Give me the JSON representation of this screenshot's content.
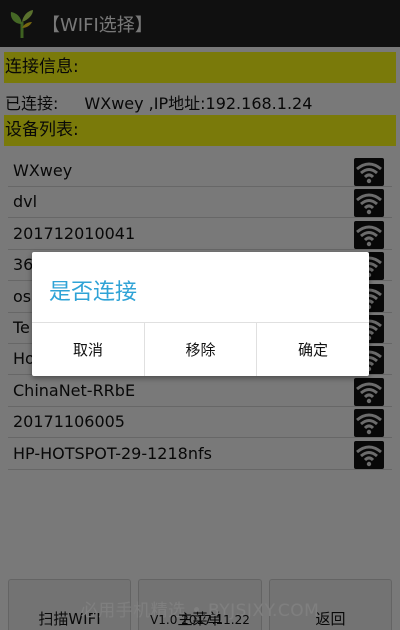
{
  "app": {
    "title": "【WIFI选择】",
    "icon": "plant-sprout-icon"
  },
  "connection": {
    "section_label": "连接信息:",
    "connected_label": "已连接:",
    "connected_value": "WXwey ,IP地址:192.168.1.24"
  },
  "devices": {
    "section_label": "设备列表:",
    "items": [
      {
        "ssid": "WXwey"
      },
      {
        "ssid": "dvl"
      },
      {
        "ssid": "201712010041"
      },
      {
        "ssid": "36"
      },
      {
        "ssid": " os"
      },
      {
        "ssid": "Te"
      },
      {
        "ssid": "Ho"
      },
      {
        "ssid": "ChinaNet-RRbE"
      },
      {
        "ssid": "20171106005"
      },
      {
        "ssid": "HP-HOTSPOT-29-1218nfs"
      }
    ],
    "signal_icon": "wifi-signal-icon"
  },
  "buttons": {
    "scan": "扫描WIFI",
    "main_menu": "主菜单",
    "back": "返回"
  },
  "watermark": "必用手机精选 • BYJSJXY.COM",
  "version": "V1.0 2017.11.22",
  "dialog": {
    "title": "是否连接",
    "cancel": "取消",
    "remove": "移除",
    "confirm": "确定"
  },
  "colors": {
    "header_yellow": "#f5f515",
    "titlebar": "#212121",
    "dialog_title": "#2fa3d6"
  }
}
